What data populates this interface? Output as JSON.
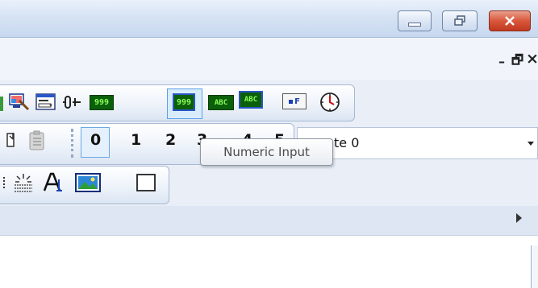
{
  "window": {
    "controls": {
      "minimize": "minimize-icon",
      "restore": "restore-icon",
      "close": "close-icon"
    },
    "mdi_controls": {
      "minimize": "–",
      "restore": "🗗",
      "close": "×"
    }
  },
  "toolbar_objects": {
    "icons": [
      "monitor-brush-icon",
      "window-list-icon",
      "bit-icon",
      "numeric-display-icon",
      "numeric-input-icon",
      "text-display-icon",
      "text-input-icon",
      "function-key-icon",
      "clock-icon"
    ],
    "numeric_display_text": "999",
    "numeric_input_text": "999",
    "text_display_text": "ABC",
    "text_input_text": "ABC",
    "function_key_text": "F"
  },
  "toolbar_states": {
    "digits": [
      "0",
      "1",
      "2",
      "3",
      "4",
      "5"
    ],
    "selected": "0",
    "state_combo": {
      "value": "te 0"
    }
  },
  "toolbar_draw": {
    "icons": [
      "align-icon",
      "dots-icon",
      "font-icon",
      "picture-icon",
      "rectangle-icon"
    ]
  },
  "tooltip": {
    "text": "Numeric Input"
  },
  "colors": {
    "title_gradient_top": "#eaf1fb",
    "close_red": "#d9573b",
    "icon_green": "#1a8a1a",
    "selection_blue": "#5aa0e8"
  }
}
